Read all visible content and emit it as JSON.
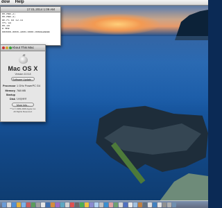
{
  "menubar": {
    "items": [
      "dow",
      "Help"
    ]
  },
  "info_window": {
    "title": "17.01.2014 1:09 AM",
    "lines": [
      "",
      "en-Mac-2;",
      "en-Mac-3;",
      "ac-PC G4 12.11",
      "rPC G4",
      "",
      "en-1B",
      "8 MHz",
      "000000-0000-1000-0000-000D93AB8E",
      "",
      ""
    ]
  },
  "about_window": {
    "title": "About This Mac",
    "heading": "Mac OS X",
    "version": "Version 10.5.8",
    "update_button": "Software Update...",
    "specs": [
      {
        "key": "Processor",
        "value": "1 GHz PowerPC G4"
      },
      {
        "key": "Memory",
        "value": "768 MB"
      },
      {
        "key": "Startup Disk",
        "value": "Leopard"
      }
    ],
    "more_button": "More Info...",
    "copyright": [
      "™ & © 1983-2009 Apple Inc.",
      "All Rights Reserved."
    ]
  },
  "dock": {
    "icon_colors": [
      "#6a9bd6",
      "#d9d9d9",
      "#4f8fd8",
      "#e0b040",
      "#7bb1e8",
      "#c75c5c",
      "#5c9c5c",
      "#a0a0a0",
      "#e6e6e6",
      "#3d6fb0",
      "#d68c3c",
      "#9b6bc7",
      "#5aa7c2",
      "#d0d0d0",
      "#e05050",
      "#6a6a6a",
      "#4caf50",
      "#f0c040",
      "#8a8ad0",
      "#b0d0f0",
      "#c0c0c0",
      "#3a8fd0",
      "#e0a0a0",
      "#70a070",
      "#d8d8d8",
      "#5070c0",
      "#e8e8e8",
      "#a0c0e0",
      "#c08040",
      "#607080",
      "#dcdcdc",
      "#4080c0",
      "#e0e0e0",
      "#909090",
      "#b0b0b0",
      "#7090b0"
    ]
  }
}
